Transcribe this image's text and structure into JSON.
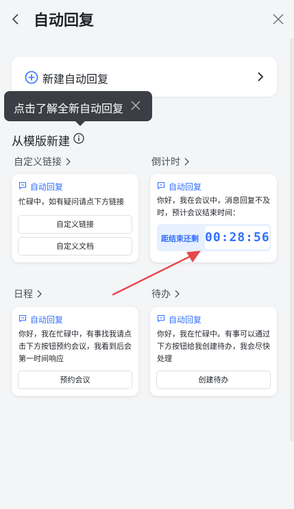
{
  "header": {
    "title": "自动回复"
  },
  "new_reply": {
    "label": "新建自动回复"
  },
  "tooltip": {
    "text": "点击了解全新自动回复"
  },
  "section": {
    "title": "从模版新建"
  },
  "categories": [
    {
      "label": "自定义链接"
    },
    {
      "label": "倒计时"
    },
    {
      "label": "日程"
    },
    {
      "label": "待办"
    }
  ],
  "cards": [
    {
      "header": "自动回复",
      "message": "忙碌中，如有疑问请点下方链接",
      "buttons": [
        "自定义链接",
        "自定义文档"
      ]
    },
    {
      "header": "自动回复",
      "message": "你好，我在会议中，消息回复不及时，预计会议结束时间：",
      "countdown_label": "距结束还剩",
      "countdown": "00:28:56"
    },
    {
      "header": "自动回复",
      "message": "你好，我在忙碌中，有事找我请点击下方按钮预约会议，我看到后会第一时间响应",
      "buttons": [
        "预约会议"
      ]
    },
    {
      "header": "自动回复",
      "message": "你好，我在忙碌中。有事可以通过下方按钮给我创建待办，我会尽快处理",
      "buttons": [
        "创建待办"
      ]
    }
  ],
  "colors": {
    "accent": "#3370ff",
    "annotation_arrow": "#e5484d",
    "tooltip_bg": "#3b3e44"
  }
}
